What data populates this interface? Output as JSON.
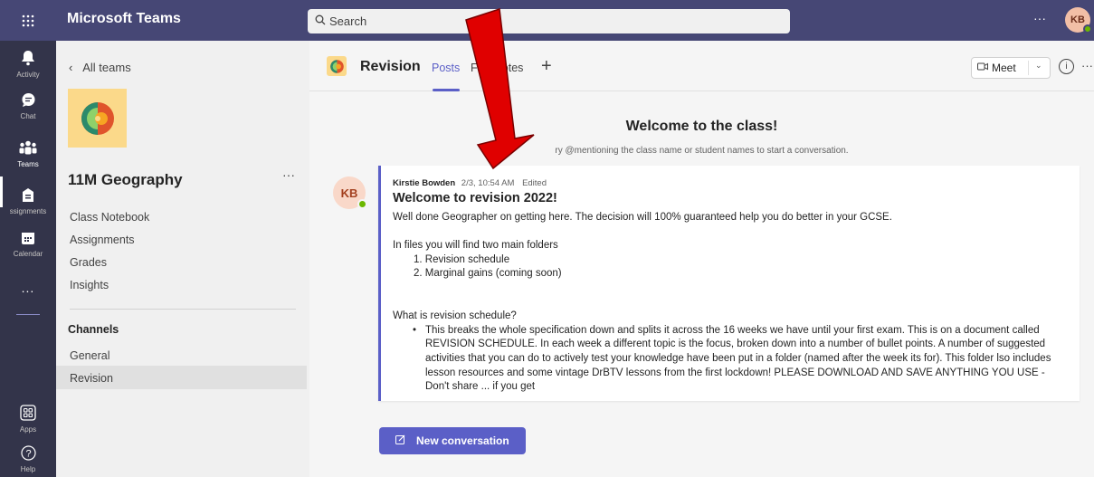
{
  "app": {
    "title": "Microsoft Teams",
    "apps_icon": "waffle-icon"
  },
  "search": {
    "placeholder": "Search"
  },
  "user": {
    "initials": "KB"
  },
  "rail": {
    "items": [
      {
        "label": "Activity",
        "icon": "bell-icon"
      },
      {
        "label": "Chat",
        "icon": "chat-icon"
      },
      {
        "label": "Teams",
        "icon": "teams-icon"
      },
      {
        "label": "ssignments",
        "icon": "assignments-icon"
      },
      {
        "label": "Calendar",
        "icon": "calendar-icon"
      },
      {
        "label": "...",
        "icon": "more-icon"
      },
      {
        "label": "Apps",
        "icon": "apps-icon"
      },
      {
        "label": "Help",
        "icon": "help-icon"
      }
    ]
  },
  "team_panel": {
    "back_label": "All teams",
    "team_name": "11M Geography",
    "nav": [
      "Class Notebook",
      "Assignments",
      "Grades",
      "Insights"
    ],
    "channels_heading": "Channels",
    "channels": [
      "General",
      "Revision"
    ]
  },
  "channel": {
    "name": "Revision",
    "tabs": [
      "Posts",
      "F",
      "lotes"
    ],
    "meet_label": "Meet"
  },
  "welcome": {
    "title": "Welcome to the class!",
    "subtitle": "ry @mentioning the class name or student names to start a conversation."
  },
  "post": {
    "author_initials": "KB",
    "author": "Kirstie Bowden",
    "timestamp": "2/3, 10:54 AM",
    "edited": "Edited",
    "title": "Welcome to revision 2022!",
    "intro": "Well done Geographer on getting here. The decision will 100% guaranteed help you do better in your GCSE.",
    "folders_intro": "In files you will find two main folders",
    "folders": [
      "1. Revision schedule",
      "2. Marginal gains (coming soon)"
    ],
    "question": "What is revision schedule?",
    "bullet": "This breaks the whole specification down and splits it across the 16 weeks we have until your first exam. This is on a document called REVISION SCHEDULE.  In each week a different topic is the focus, broken down into a number of bullet points. A number of suggested activities that you can do to actively test your knowledge have been put in a folder (named after the week its for). This folder lso includes lesson resources and some vintage DrBTV lessons from the first lockdown! PLEASE DOWNLOAD AND SAVE ANYTHING YOU USE - Don't share ... if you get"
  },
  "actions": {
    "new_conversation": "New conversation"
  },
  "colors": {
    "brand": "#464775",
    "accent": "#5b5fc7",
    "rail": "#33344a",
    "arrow": "#e00000"
  }
}
